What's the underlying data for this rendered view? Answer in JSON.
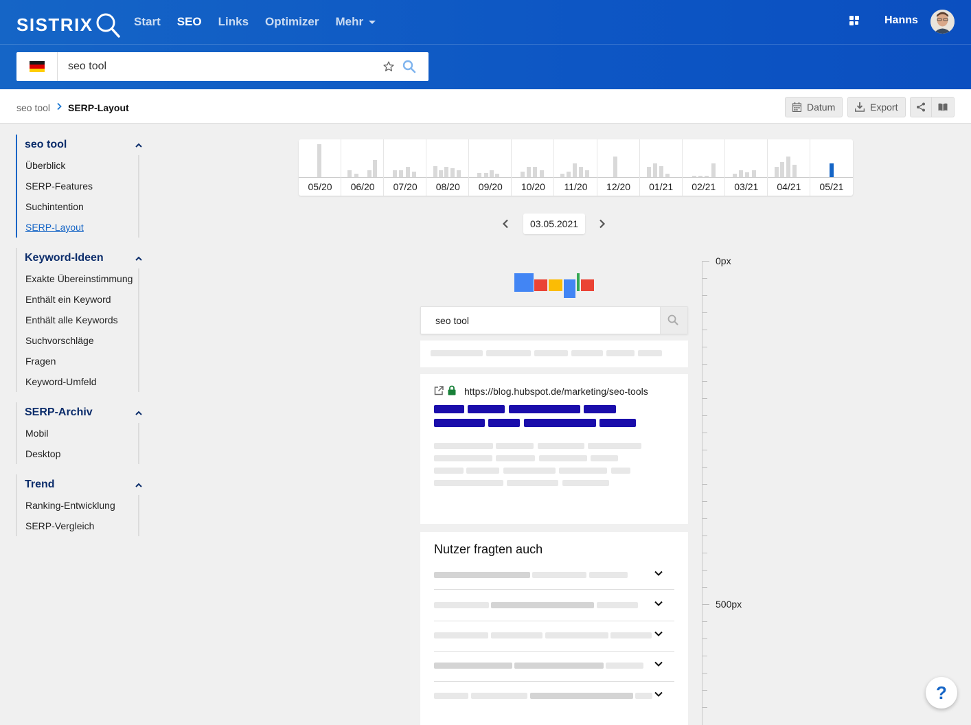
{
  "header": {
    "logo_text": "SISTRIX",
    "nav": [
      {
        "label": "Start",
        "active": false
      },
      {
        "label": "SEO",
        "active": true
      },
      {
        "label": "Links",
        "active": false
      },
      {
        "label": "Optimizer",
        "active": false
      },
      {
        "label": "Mehr",
        "active": false
      }
    ],
    "user_name": "Hanns"
  },
  "search": {
    "country_flag": "de-flag-icon",
    "value": "seo tool"
  },
  "breadcrumb": {
    "parent": "seo tool",
    "current": "SERP-Layout"
  },
  "toolbar": {
    "date_label": "Datum",
    "export_label": "Export"
  },
  "sidebar": {
    "groups": [
      {
        "title": "seo tool",
        "items": [
          "Überblick",
          "SERP-Features",
          "Suchintention",
          "SERP-Layout"
        ],
        "active_item": "SERP-Layout"
      },
      {
        "title": "Keyword-Ideen",
        "items": [
          "Exakte Übereinstimmung",
          "Enthält ein Keyword",
          "Enthält alle Keywords",
          "Suchvorschläge",
          "Fragen",
          "Keyword-Umfeld"
        ]
      },
      {
        "title": "SERP-Archiv",
        "items": [
          "Mobil",
          "Desktop"
        ]
      },
      {
        "title": "Trend",
        "items": [
          "Ranking-Entwicklung",
          "SERP-Vergleich"
        ]
      }
    ]
  },
  "timeline": {
    "months": [
      "05/20",
      "06/20",
      "07/20",
      "08/20",
      "09/20",
      "10/20",
      "11/20",
      "12/20",
      "01/21",
      "02/21",
      "03/21",
      "04/21",
      "05/21"
    ],
    "selected_month": "05/21",
    "selected_date": "03.05.2021"
  },
  "ruler": {
    "top_label": "0px",
    "mid_label": "500px"
  },
  "serp": {
    "query": "seo tool",
    "result_url": "https://blog.hubspot.de/marketing/seo-tools",
    "paa_title": "Nutzer fragten auch",
    "paa_count": 5
  },
  "help_label": "?",
  "colors": {
    "brand_blue": "#1565c6",
    "serp_title_blue": "#1a0dab",
    "lock_green": "#188038"
  }
}
